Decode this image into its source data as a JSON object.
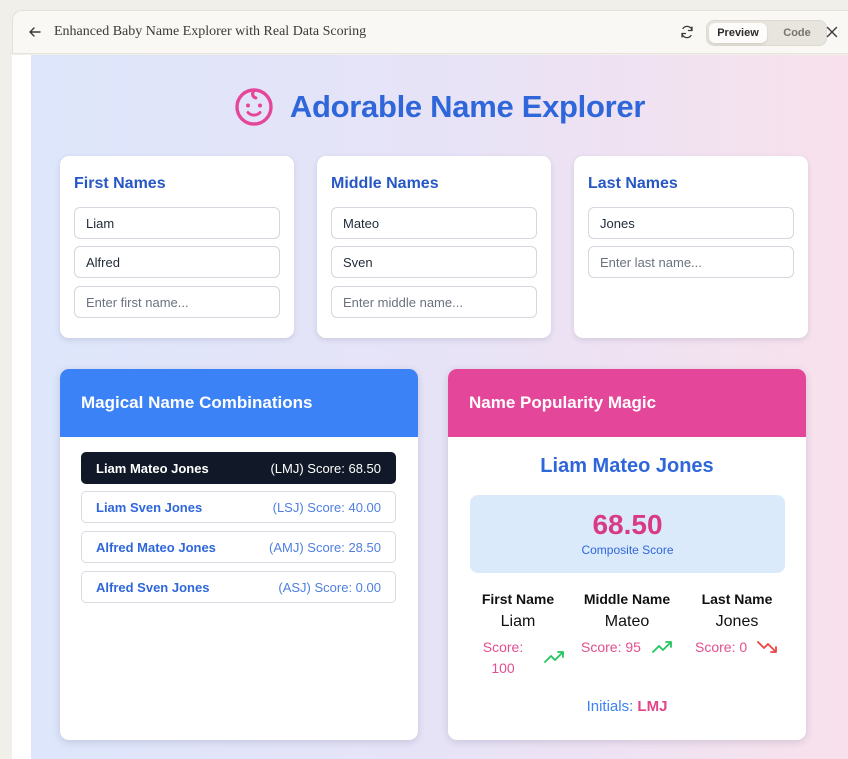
{
  "window": {
    "title": "Enhanced Baby Name Explorer with Real Data Scoring",
    "preview_label": "Preview",
    "code_label": "Code"
  },
  "app": {
    "title": "Adorable Name Explorer",
    "colors": {
      "primary": "#2f67da",
      "pink": "#e4479a",
      "blue_header": "#3b82f6",
      "active_row": "#111827"
    }
  },
  "inputs": {
    "first": {
      "title": "First Names",
      "values": [
        "Liam",
        "Alfred"
      ],
      "placeholder": "Enter first name..."
    },
    "middle": {
      "title": "Middle Names",
      "values": [
        "Mateo",
        "Sven"
      ],
      "placeholder": "Enter middle name..."
    },
    "last": {
      "title": "Last Names",
      "values": [
        "Jones"
      ],
      "placeholder": "Enter last name..."
    }
  },
  "combinations": {
    "title": "Magical Name Combinations",
    "items": [
      {
        "name": "Liam Mateo Jones",
        "meta": "(LMJ) Score: 68.50",
        "selected": true
      },
      {
        "name": "Liam Sven Jones",
        "meta": "(LSJ) Score: 40.00",
        "selected": false
      },
      {
        "name": "Alfred Mateo Jones",
        "meta": "(AMJ) Score: 28.50",
        "selected": false
      },
      {
        "name": "Alfred Sven Jones",
        "meta": "(ASJ) Score: 0.00",
        "selected": false
      }
    ]
  },
  "popularity": {
    "title": "Name Popularity Magic",
    "selected_name": "Liam Mateo Jones",
    "composite_score": "68.50",
    "composite_label": "Composite Score",
    "parts": [
      {
        "heading": "First Name",
        "name": "Liam",
        "score_line1": "Score:",
        "score_line2": "100",
        "trend": "trend-up-icon"
      },
      {
        "heading": "Middle Name",
        "name": "Mateo",
        "score_line1": "Score: 95",
        "score_line2": "",
        "trend": "trend-up-icon"
      },
      {
        "heading": "Last Name",
        "name": "Jones",
        "score_line1": "Score: 0",
        "score_line2": "",
        "trend": "trend-down-icon"
      }
    ],
    "initials_label": "Initials:",
    "initials": "LMJ"
  }
}
